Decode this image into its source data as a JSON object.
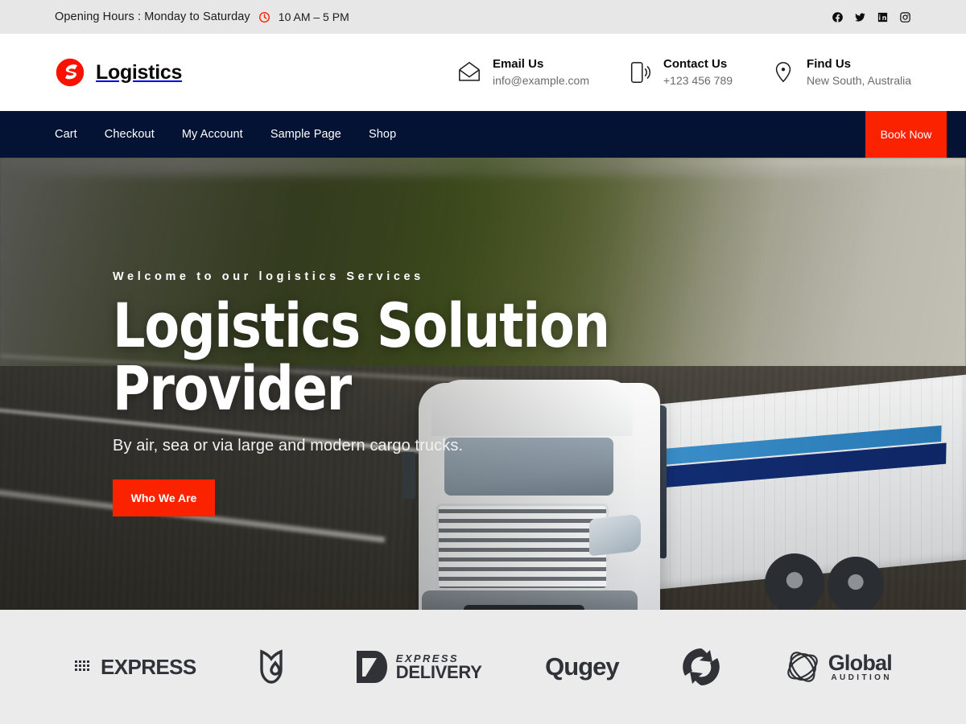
{
  "topbar": {
    "opening_hours_label": "Opening Hours : Monday to Saturday",
    "hours_value": "10 AM – 5 PM",
    "clock_icon": "clock-icon",
    "clock_color": "#fb2200",
    "background": "#e7e7e7",
    "socials": [
      {
        "name": "facebook-icon",
        "label": "Facebook"
      },
      {
        "name": "twitter-icon",
        "label": "Twitter"
      },
      {
        "name": "linkedin-icon",
        "label": "LinkedIn"
      },
      {
        "name": "instagram-icon",
        "label": "Instagram"
      }
    ]
  },
  "header": {
    "brand_name": "Logistics",
    "brand_mark": "logistics-swoosh-logo",
    "brand_color": "#fb1100",
    "contacts": [
      {
        "icon": "envelope-icon",
        "title": "Email Us",
        "value": "info@example.com"
      },
      {
        "icon": "mobile-phone-icon",
        "title": "Contact Us",
        "value": "+123 456 789"
      },
      {
        "icon": "map-pin-icon",
        "title": "Find Us",
        "value": "New South, Australia"
      }
    ]
  },
  "nav": {
    "background": "#041233",
    "items": [
      {
        "label": "Cart"
      },
      {
        "label": "Checkout"
      },
      {
        "label": "My Account"
      },
      {
        "label": "Sample Page"
      },
      {
        "label": "Shop"
      }
    ],
    "cta_label": "Book Now",
    "cta_color": "#fb2200"
  },
  "hero": {
    "eyebrow": "Welcome to our logistics Services",
    "title": "Logistics Solution Provider",
    "subtitle": "By air, sea or via large and modern cargo trucks.",
    "cta_label": "Who We Are",
    "cta_color": "#fb2200",
    "image_alt": "white semi truck driving on highway with motion blur"
  },
  "partners": {
    "background": "#ebebeb",
    "logos": [
      {
        "name": "express-logo",
        "word": "EXPRESS",
        "mark": "dot-matrix-icon"
      },
      {
        "name": "tulip-shield-logo",
        "word": "",
        "mark": "tulip-droplet-icon"
      },
      {
        "name": "express-delivery-logo",
        "small": "EXPRESS",
        "big": "DELIVERY",
        "mark": "d-arrow-icon"
      },
      {
        "name": "qugey-logo",
        "word": "Qugey",
        "mark": ""
      },
      {
        "name": "swoosh-circle-logo",
        "word": "",
        "mark": "arrow-swoosh-icon"
      },
      {
        "name": "global-audition-logo",
        "word": "Global",
        "small": "AUDITION",
        "mark": "sphere-globe-icon"
      }
    ]
  }
}
